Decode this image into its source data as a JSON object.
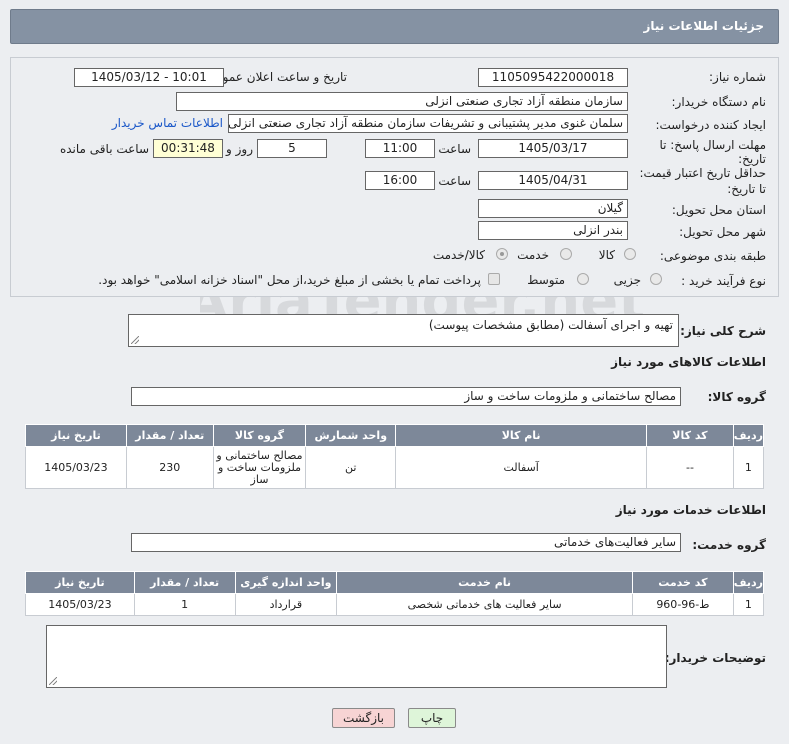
{
  "header": {
    "title": "جزئیات اطلاعات نیاز"
  },
  "form": {
    "need_number_label": "شماره نیاز:",
    "need_number": "1105095422000018",
    "announce_label": "تاریخ و ساعت اعلان عمومی:",
    "announce_value": "1405/03/12 - 10:01",
    "buyer_org_label": "نام دستگاه خریدار:",
    "buyer_org": "سازمان منطقه آزاد تجاری  صنعتی انزلی",
    "creator_label": "ایجاد کننده درخواست:",
    "creator": "سلمان غنوی مدیر پشتیبانی و تشریفات سازمان منطقه آزاد تجاری  صنعتی انزلی",
    "contact_link": "اطلاعات تماس خریدار",
    "reply_label_1": "مهلت ارسال پاسخ: تا",
    "reply_label_2": "تاریخ:",
    "reply_date": "1405/03/17",
    "time_label": "ساعت",
    "reply_time": "11:00",
    "reply_days": "5",
    "days_label": "روز و",
    "remaining_time": "00:31:48",
    "remaining_label": "ساعت باقی مانده",
    "validity_label_1": "حداقل تاریخ اعتبار قیمت:",
    "validity_label_2": "تا تاریخ:",
    "validity_date": "1405/04/31",
    "validity_time": "16:00",
    "province_label": "استان محل تحویل:",
    "province": "گیلان",
    "city_label": "شهر محل تحویل:",
    "city": "بندر انزلی",
    "category_label": "طبقه بندی موضوعی:",
    "category_options": [
      "کالا",
      "خدمت",
      "کالا/خدمت"
    ],
    "process_label": "نوع فرآیند خرید :",
    "process_options": [
      "جزیی",
      "متوسط"
    ],
    "payment_note": "پرداخت تمام یا بخشی از مبلغ خرید،از محل \"اسناد خزانه اسلامی\" خواهد بود."
  },
  "summary": {
    "label": "شرح کلی نیاز:",
    "text": "تهیه و اجرای آسفالت (مطابق مشخصات پیوست)"
  },
  "goods": {
    "section_title": "اطلاعات کالاهای مورد نیاز",
    "group_label": "گروه کالا:",
    "group_value": "مصالح ساختمانی و ملزومات ساخت و ساز",
    "columns": [
      "ردیف",
      "کد کالا",
      "نام کالا",
      "واحد شمارش",
      "گروه کالا",
      "تعداد / مقدار",
      "تاریخ نیاز"
    ],
    "rows": [
      {
        "row": "1",
        "code": "--",
        "name": "آسفالت",
        "unit": "تن",
        "group": "مصالح ساختمانی و ملزومات ساخت و ساز",
        "qty": "230",
        "date": "1405/03/23"
      }
    ]
  },
  "services": {
    "section_title": "اطلاعات خدمات مورد نیاز",
    "group_label": "گروه خدمت:",
    "group_value": "سایر فعالیت‌های خدماتی",
    "columns": [
      "ردیف",
      "کد خدمت",
      "نام خدمت",
      "واحد اندازه گیری",
      "تعداد / مقدار",
      "تاریخ نیاز"
    ],
    "rows": [
      {
        "row": "1",
        "code": "ط-96-960",
        "name": "سایر فعالیت های خدماتی شخصی",
        "unit": "قرارداد",
        "qty": "1",
        "date": "1405/03/23"
      }
    ]
  },
  "buyer_notes": {
    "label": "توضیحات خریدار:"
  },
  "buttons": {
    "print": "چاپ",
    "back": "بازگشت"
  },
  "watermark": {
    "text": "AriaTender.net"
  },
  "colors": {
    "header_bg": "#8592a3",
    "table_header_bg": "#7d8899",
    "link": "#1a57c8",
    "highlight": "#ffffd5",
    "back_button": "#f7d4d4",
    "print_button": "#def5d9"
  }
}
